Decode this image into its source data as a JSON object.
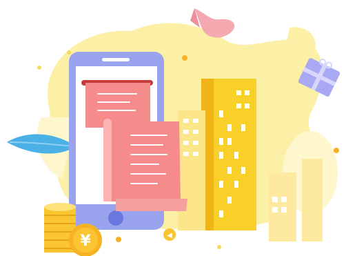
{
  "illustration": {
    "coin_symbol": "¥",
    "small_coin_symbol": "◀",
    "colors": {
      "blob_yellow": "#fcefa6",
      "blob_light": "#fef6cc",
      "phone_frame": "#9aa3ee",
      "phone_screen": "#ffffff",
      "phone_button": "#6b77e0",
      "receipt_pink": "#f58b8b",
      "receipt_light": "#fbb3b3",
      "building_yellow": "#f9cf2a",
      "building_dark": "#f1b418",
      "leaf_blue": "#4ab0e6",
      "coin_gold": "#fbc531",
      "coin_dark": "#e9a414",
      "ribbon_pink": "#f4a9b0",
      "gift_purple": "#a9a8f2"
    },
    "icons": [
      "phone-icon",
      "receipt-icon",
      "building-icon",
      "coin-stack-icon",
      "yen-coin-icon",
      "leaf-icon",
      "gift-box-icon",
      "ribbon-icon"
    ]
  }
}
